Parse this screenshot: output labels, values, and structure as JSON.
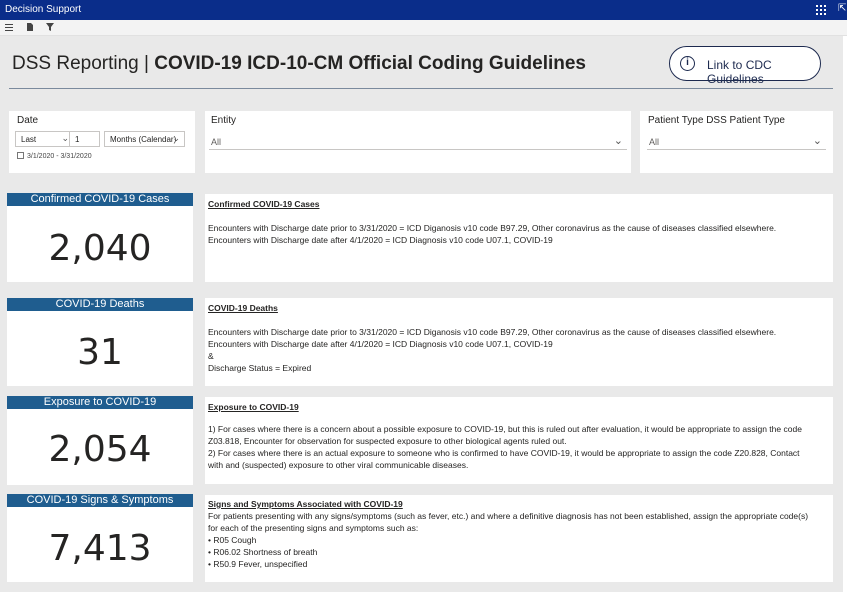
{
  "app": {
    "title": "Decision Support",
    "expand_glyph": "⇱"
  },
  "toolbar": {
    "icons": [
      "menu-icon",
      "page-icon",
      "filter-icon"
    ]
  },
  "page": {
    "title_prefix": "DSS Reporting | ",
    "title_bold": "COVID-19 ICD-10-CM Official Coding Guidelines"
  },
  "cdc_button": {
    "info_glyph": "i",
    "label": "Link to CDC Guidelines"
  },
  "slicers": {
    "date": {
      "title": "Date",
      "relative": "Last",
      "count": "1",
      "unit": "Months (Calendar)",
      "range": "3/1/2020 - 3/31/2020"
    },
    "entity": {
      "title": "Entity",
      "value": "All"
    },
    "patient_type": {
      "title": "Patient Type DSS Patient Type",
      "value": "All"
    }
  },
  "kpis": [
    {
      "label": "Confirmed COVID-19 Cases",
      "value": "2,040"
    },
    {
      "label": "COVID-19 Deaths",
      "value": "31"
    },
    {
      "label": "Exposure to COVID-19",
      "value": "2,054"
    },
    {
      "label": "COVID-19 Signs & Symptoms",
      "value": "7,413"
    }
  ],
  "descriptions": [
    {
      "heading": "Confirmed COVID-19 Cases",
      "lines": [
        "Encounters with Discharge date prior to 3/31/2020 = ICD Diganosis v10 code B97.29, Other coronavirus as the cause of diseases classified elsewhere.",
        "Encounters with Discharge date after 4/1/2020 = ICD Diagnosis v10 code U07.1, COVID-19"
      ]
    },
    {
      "heading": "COVID-19 Deaths",
      "lines": [
        "Encounters with Discharge date prior to 3/31/2020 = ICD Diganosis v10 code B97.29, Other coronavirus as the cause of diseases classified elsewhere.",
        "Encounters with Discharge date after 4/1/2020 = ICD Diagnosis v10 code U07.1, COVID-19",
        "&",
        "Discharge Status = Expired"
      ]
    },
    {
      "heading": "Exposure to COVID-19",
      "lines": [
        "1) For cases where there is a concern about a possible exposure to COVID-19, but this is ruled out after evaluation, it would be appropriate to assign the code",
        "Z03.818, Encounter for observation for suspected exposure to other biological agents ruled out.",
        "2) For cases where there is an actual exposure to someone who is confirmed to have COVID-19, it would be appropriate to assign the code Z20.828, Contact",
        "with and (suspected) exposure to other viral communicable diseases."
      ]
    },
    {
      "heading": "Signs and Symptoms Associated with COVID-19",
      "lines": [
        "For patients presenting with any signs/symptoms (such as fever, etc.) and where a definitive diagnosis has not been established, assign the appropriate code(s)",
        "for each of the presenting signs and symptoms such as:",
        "• R05 Cough",
        "• R06.02 Shortness of breath",
        "• R50.9 Fever, unspecified"
      ]
    }
  ],
  "colors": {
    "appbar": "#0a2d8a",
    "kpi_header": "#1f5d8f",
    "canvas": "#e9e9e9"
  }
}
